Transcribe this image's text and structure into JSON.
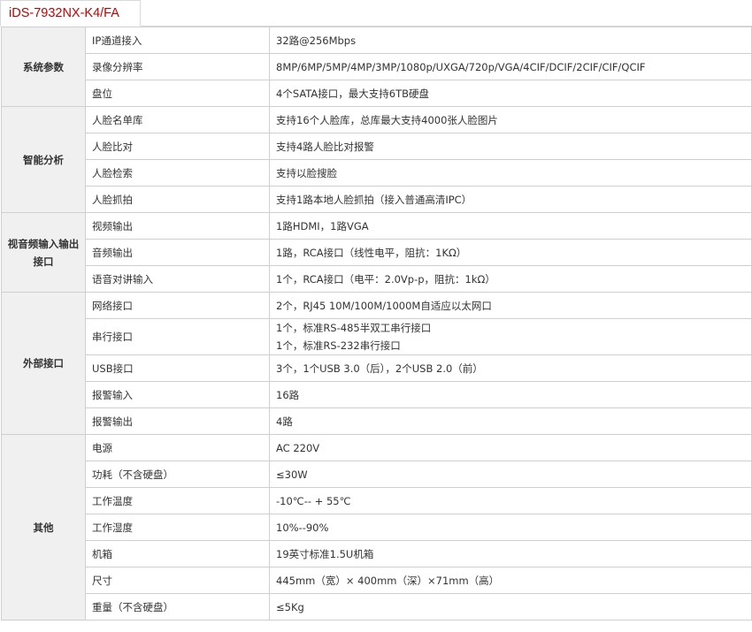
{
  "tab": {
    "model": "iDS-7932NX-K4/FA"
  },
  "colors": {
    "accent": "#c40000",
    "group_bg": "#f0f0f0",
    "border": "#cfcfcf"
  },
  "groups": [
    {
      "title": "系统参数",
      "rows": [
        {
          "label": "IP通道接入",
          "values": [
            "32路@256Mbps"
          ]
        },
        {
          "label": "录像分辨率",
          "values": [
            "8MP/6MP/5MP/4MP/3MP/1080p/UXGA/720p/VGA/4CIF/DCIF/2CIF/CIF/QCIF"
          ]
        },
        {
          "label": "盘位",
          "values": [
            "4个SATA接口，最大支持6TB硬盘"
          ]
        }
      ]
    },
    {
      "title": "智能分析",
      "rows": [
        {
          "label": "人脸名单库",
          "values": [
            "支持16个人脸库，总库最大支持4000张人脸图片"
          ]
        },
        {
          "label": "人脸比对",
          "values": [
            "支持4路人脸比对报警"
          ]
        },
        {
          "label": "人脸检索",
          "values": [
            "支持以脸搜脸"
          ]
        },
        {
          "label": "人脸抓拍",
          "values": [
            "支持1路本地人脸抓拍（接入普通高清IPC）"
          ]
        }
      ]
    },
    {
      "title": "视音频输入输出接口",
      "rows": [
        {
          "label": "视频输出",
          "values": [
            "1路HDMI，1路VGA"
          ]
        },
        {
          "label": "音频输出",
          "values": [
            "1路，RCA接口（线性电平，阻抗：1KΩ）"
          ]
        },
        {
          "label": "语音对讲输入",
          "values": [
            "1个，RCA接口（电平：2.0Vp-p，阻抗：1kΩ）"
          ]
        }
      ]
    },
    {
      "title": "外部接口",
      "rows": [
        {
          "label": "网络接口",
          "values": [
            "2个，RJ45 10M/100M/1000M自适应以太网口"
          ]
        },
        {
          "label": "串行接口",
          "values": [
            "1个，标准RS-485半双工串行接口",
            "1个，标准RS-232串行接口"
          ]
        },
        {
          "label": "USB接口",
          "values": [
            "3个，1个USB 3.0（后），2个USB 2.0（前）"
          ]
        },
        {
          "label": "报警输入",
          "values": [
            "16路"
          ]
        },
        {
          "label": "报警输出",
          "values": [
            "4路"
          ]
        }
      ]
    },
    {
      "title": "其他",
      "rows": [
        {
          "label": "电源",
          "values": [
            "AC 220V"
          ]
        },
        {
          "label": "功耗（不含硬盘）",
          "values": [
            "≤30W"
          ]
        },
        {
          "label": "工作温度",
          "values": [
            "-10℃-- + 55℃"
          ]
        },
        {
          "label": "工作湿度",
          "values": [
            "10%--90%"
          ]
        },
        {
          "label": "机箱",
          "values": [
            "19英寸标准1.5U机箱"
          ]
        },
        {
          "label": "尺寸",
          "values": [
            "445mm（宽）× 400mm（深）×71mm（高）"
          ]
        },
        {
          "label": "重量（不含硬盘）",
          "values": [
            "≤5Kg"
          ]
        }
      ]
    }
  ]
}
